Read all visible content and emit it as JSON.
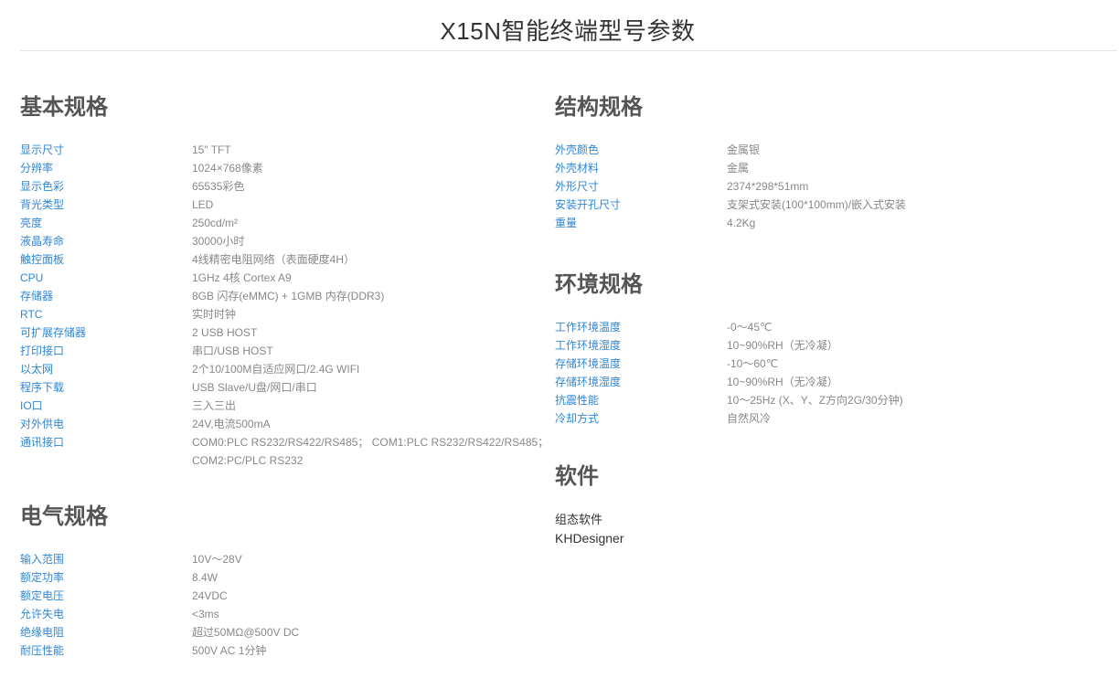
{
  "page": {
    "title": "X15N智能终端型号参数"
  },
  "sections": {
    "basic": {
      "title": "基本规格",
      "rows": [
        {
          "label": "显示尺寸",
          "value": "15\" TFT"
        },
        {
          "label": "分辨率",
          "value": "1024×768像素"
        },
        {
          "label": "显示色彩",
          "value": "65535彩色"
        },
        {
          "label": "背光类型",
          "value": "LED"
        },
        {
          "label": "亮度",
          "value": "250cd/m²"
        },
        {
          "label": "液晶寿命",
          "value": "30000小时"
        },
        {
          "label": "触控面板",
          "value": "4线精密电阻网络（表面硬度4H）"
        },
        {
          "label": "CPU",
          "value": "1GHz 4核 Cortex A9"
        },
        {
          "label": "存储器",
          "value": "8GB 闪存(eMMC) + 1GMB 内存(DDR3)"
        },
        {
          "label": "RTC",
          "value": "实时时钟"
        },
        {
          "label": "可扩展存储器",
          "value": "2 USB HOST"
        },
        {
          "label": "打印接口",
          "value": "串口/USB HOST"
        },
        {
          "label": "以太网",
          "value": "2个10/100M自适应网口/2.4G WIFI"
        },
        {
          "label": "程序下载",
          "value": "USB Slave/U盘/网口/串口"
        },
        {
          "label": "IO口",
          "value": "三入三出"
        },
        {
          "label": "对外供电",
          "value": "24V,电流500mA"
        },
        {
          "label": "通讯接口",
          "value": "COM0:PLC RS232/RS422/RS485；  COM1:PLC RS232/RS422/RS485；  COM2:PC/PLC RS232"
        }
      ]
    },
    "electrical": {
      "title": "电气规格",
      "rows": [
        {
          "label": "输入范围",
          "value": "10V～28V"
        },
        {
          "label": "额定功率",
          "value": "8.4W"
        },
        {
          "label": "额定电压",
          "value": "24VDC"
        },
        {
          "label": "允许失电",
          "value": "<3ms"
        },
        {
          "label": "绝缘电阻",
          "value": "超过50MΩ@500V DC"
        },
        {
          "label": "耐压性能",
          "value": "500V AC 1分钟"
        }
      ]
    },
    "structure": {
      "title": "结构规格",
      "rows": [
        {
          "label": "外壳颜色",
          "value": "金属银"
        },
        {
          "label": "外壳材料",
          "value": "金属"
        },
        {
          "label": "外形尺寸",
          "value": "2374*298*51mm"
        },
        {
          "label": "安装开孔尺寸",
          "value": "支架式安装(100*100mm)/嵌入式安装"
        },
        {
          "label": "重量",
          "value": "4.2Kg"
        }
      ]
    },
    "environment": {
      "title": "环境规格",
      "rows": [
        {
          "label": "工作环境温度",
          "value": "-0～45℃"
        },
        {
          "label": "工作环境湿度",
          "value": "10~90%RH（无冷凝）"
        },
        {
          "label": "存储环境温度",
          "value": "-10～60℃"
        },
        {
          "label": "存储环境湿度",
          "value": "10~90%RH（无冷凝）"
        },
        {
          "label": "抗震性能",
          "value": "10～25Hz (X、Y、Z方向2G/30分钟)"
        },
        {
          "label": "冷却方式",
          "value": "自然风冷"
        }
      ]
    },
    "software": {
      "title": "软件",
      "category": "组态软件",
      "name": "KHDesigner"
    }
  },
  "colors": {
    "label": "#2f86d6",
    "value": "#888888",
    "heading": "#555555",
    "title": "#333333"
  }
}
